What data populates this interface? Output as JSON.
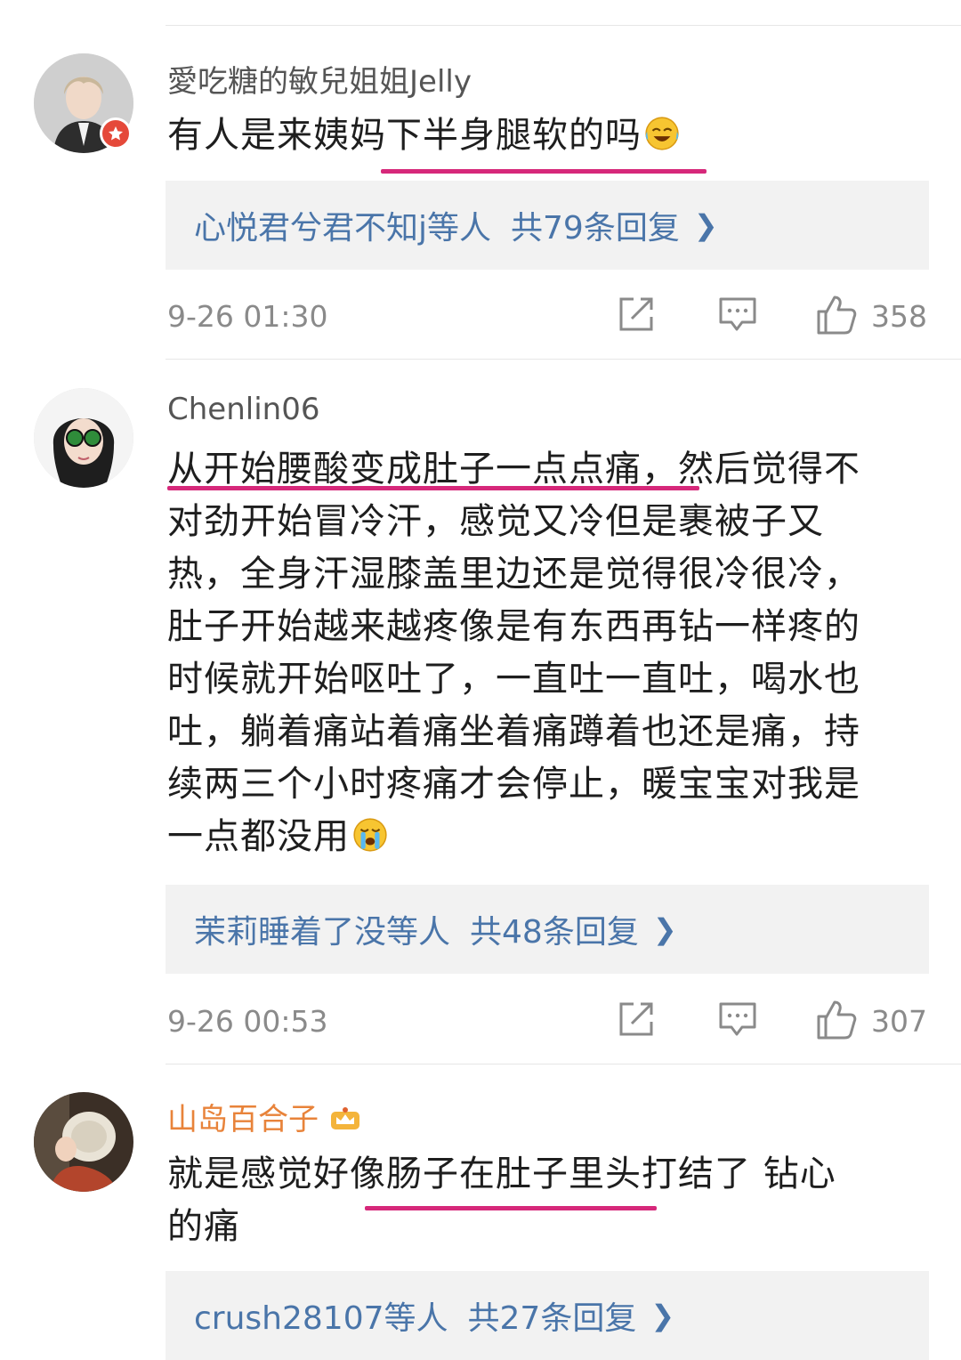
{
  "comments": [
    {
      "username": "愛吃糖的敏兒姐姐Jelly",
      "text": "有人是来姨妈下半身腿软的吗",
      "emoji": "laughing-crying-emoji",
      "replies_who": "心悦君兮君不知j等人",
      "replies_count": "共79条回复",
      "time": "9-26 01:30",
      "likes": "358"
    },
    {
      "username": "Chenlin06",
      "lines": [
        "从开始腰酸变成肚子一点点痛，然后觉得不",
        "对劲开始冒冷汗，感觉又冷但是裹被子又",
        "热，全身汗湿膝盖里边还是觉得很冷很冷，",
        "肚子开始越来越疼像是有东西再钻一样疼的",
        "时候就开始呕吐了，一直吐一直吐，喝水也",
        "吐，躺着痛站着痛坐着痛蹲着也还是痛，持",
        "续两三个小时疼痛才会停止，暖宝宝对我是",
        "一点都没用"
      ],
      "emoji": "crying-emoji",
      "replies_who": "茉莉睡着了没等人",
      "replies_count": "共48条回复",
      "time": "9-26 00:53",
      "likes": "307"
    },
    {
      "username": "山岛百合子",
      "badge": "crown-icon",
      "lines": [
        "就是感觉好像肠子在肚子里头打结了 钻心",
        "的痛"
      ],
      "replies_who": "crush28107等人",
      "replies_count": "共27条回复"
    }
  ],
  "colors": {
    "link": "#4a75a9",
    "underline": "#d6287a",
    "orange_name": "#e8833a",
    "reply_bg": "#f2f2f2"
  },
  "icons": [
    "share-icon",
    "comment-icon",
    "like-icon",
    "chevron-right-icon"
  ]
}
